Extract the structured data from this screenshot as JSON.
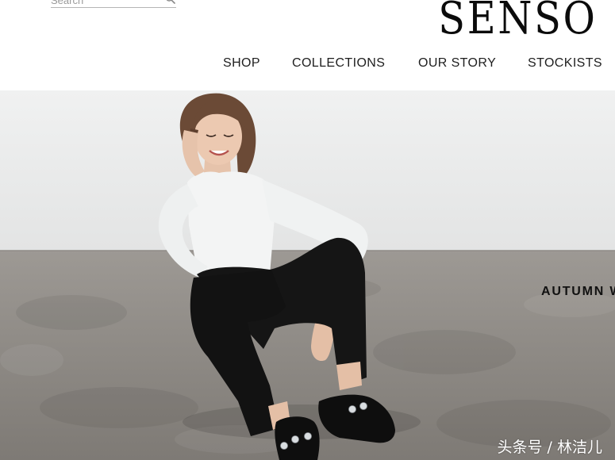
{
  "search": {
    "placeholder": "Search",
    "value": ""
  },
  "brand": {
    "logo_text": "SENSO"
  },
  "nav": {
    "items": [
      "SHOP",
      "COLLECTIONS",
      "OUR STORY",
      "STOCKISTS"
    ]
  },
  "hero": {
    "caption": "AUTUMN W",
    "image_subject": "model-seated-on-concrete-floor"
  },
  "watermark": {
    "text": "头条号 / 林洁儿"
  },
  "icons": {
    "search": "search-icon"
  },
  "colors": {
    "text": "#1e1e1e",
    "wall": "#e9eaea",
    "floor": "#8e8a84",
    "outfit_top": "#f4f5f5",
    "outfit_pants": "#141414"
  }
}
